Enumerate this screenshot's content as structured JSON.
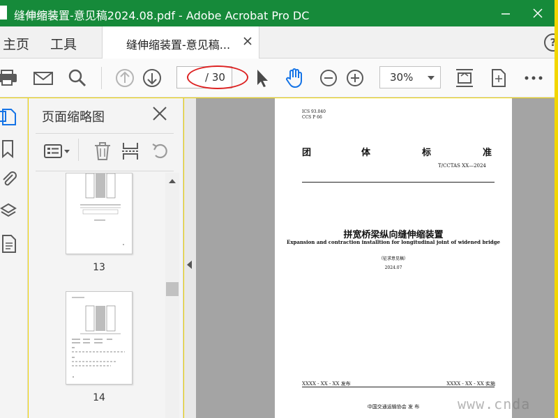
{
  "window": {
    "title": "缝伸缩装置-意见稿2024.08.pdf - Adobe Acrobat Pro DC",
    "title_watermark": "缝伸缩"
  },
  "tabs": {
    "home": "主页",
    "tools": "工具",
    "document": "缝伸缩装置-意见稿...",
    "help": "?"
  },
  "toolbar": {
    "page_current": "",
    "page_total": "/ 30",
    "zoom": "30%",
    "icons": [
      "print-icon",
      "email-icon",
      "search-icon",
      "page-up-icon",
      "page-down-icon",
      "select-pointer-icon",
      "hand-tool-icon",
      "zoom-out-icon",
      "zoom-in-icon",
      "fit-page-icon",
      "rotate-view-icon",
      "more-icon"
    ]
  },
  "sidebar": {
    "title": "页面缩略图",
    "thumbnails": [
      {
        "label": "13"
      },
      {
        "label": "14"
      }
    ]
  },
  "document": {
    "ics": "ICS  93.040",
    "ccs": "CCS  P 66",
    "standard_chars": [
      "团",
      "体",
      "标",
      "准"
    ],
    "code": "T/CCTAS  XX—2024",
    "title_cn": "拼宽桥梁纵向缝伸缩装置",
    "title_en": "Expansion and contraction installtion for longitudinal joint of widened bridge",
    "draft_label": "（征求意见稿）",
    "date": "2024.07",
    "publish": "XXXX - XX - XX 发布",
    "implement": "XXXX - XX - XX 实施",
    "organization": "中国交通运输协会    发  布"
  },
  "watermark_text": "www.cnda",
  "colors": {
    "titlebar": "#168a3a",
    "frame": "#f2d600",
    "annotation_oval": "#d22222",
    "accent_blue": "#1473e6"
  }
}
